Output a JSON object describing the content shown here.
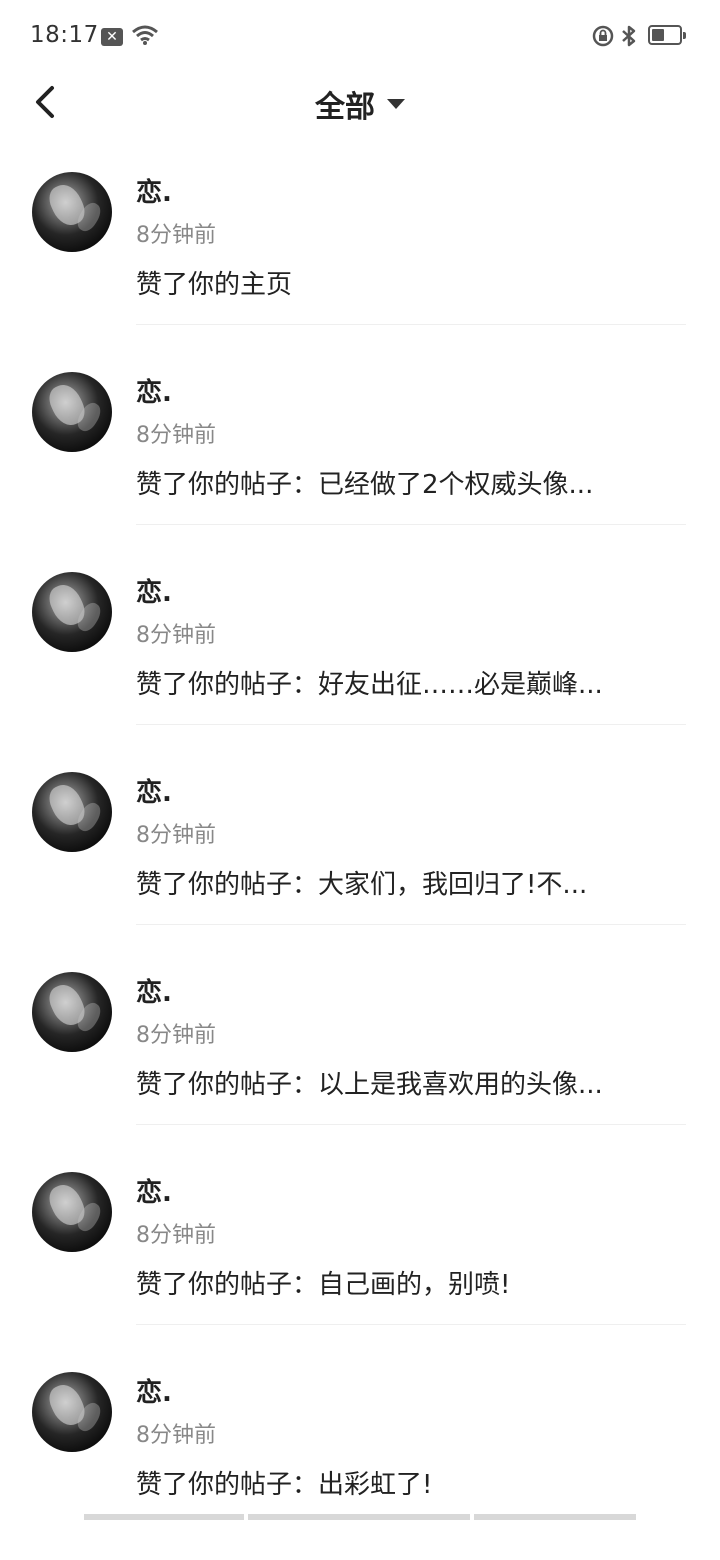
{
  "status_bar": {
    "time": "18:17",
    "notification_icon": "x-box-icon",
    "wifi_icon": "wifi-icon",
    "lock_icon": "rotation-lock-icon",
    "bluetooth_icon": "bluetooth-icon",
    "battery_level": 0.45
  },
  "header": {
    "back_icon": "chevron-left-icon",
    "title": "全部",
    "dropdown_icon": "caret-down-icon"
  },
  "notifications": [
    {
      "name": "恋.",
      "time": "8分钟前",
      "text": "赞了你的主页"
    },
    {
      "name": "恋.",
      "time": "8分钟前",
      "text": "赞了你的帖子：已经做了2个权威头像..."
    },
    {
      "name": "恋.",
      "time": "8分钟前",
      "text": "赞了你的帖子：好友出征……必是巅峰..."
    },
    {
      "name": "恋.",
      "time": "8分钟前",
      "text": "赞了你的帖子：大家们，我回归了!不..."
    },
    {
      "name": "恋.",
      "time": "8分钟前",
      "text": "赞了你的帖子：以上是我喜欢用的头像..."
    },
    {
      "name": "恋.",
      "time": "8分钟前",
      "text": "赞了你的帖子：自己画的，别喷!"
    },
    {
      "name": "恋.",
      "time": "8分钟前",
      "text": "赞了你的帖子：出彩虹了!"
    }
  ],
  "colors": {
    "background": "#ffffff",
    "text_primary": "#222222",
    "text_secondary": "#888888",
    "divider": "#efefef"
  }
}
